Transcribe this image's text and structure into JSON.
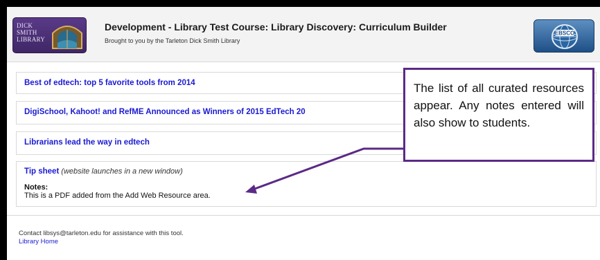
{
  "header": {
    "logo_left_text": "DICK\nSMITH\nLIBRARY",
    "title": "Development - Library Test Course: Library Discovery: Curriculum Builder",
    "subtitle": "Brought to you by the Tarleton Dick Smith Library",
    "logo_right_text": "EBSCO"
  },
  "resources": [
    {
      "title": "Best of edtech: top 5 favorite tools from 2014"
    },
    {
      "title": "DigiSchool, Kahoot! and RefME Announced as Winners of 2015 EdTech 20"
    },
    {
      "title": "Librarians lead the way in edtech"
    },
    {
      "title": "Tip sheet",
      "link_note": "(website launches in a new window)",
      "notes_label": "Notes:",
      "notes": "This is a PDF added from the Add Web Resource area."
    }
  ],
  "callout": {
    "text": "The list of all curated resources appear. Any notes entered will also show to students."
  },
  "footer": {
    "contact": "Contact libsys@tarleton.edu for assistance with this tool.",
    "home_link": "Library Home"
  },
  "colors": {
    "link": "#1a1ad1",
    "callout_border": "#5b2a86",
    "logo_purple": "#4a2f74",
    "ebsco_blue": "#2d5f96"
  },
  "icons": {
    "logo_left": "library-arch-logo",
    "logo_right": "ebsco-logo",
    "callout_arrow": "arrow-icon"
  }
}
